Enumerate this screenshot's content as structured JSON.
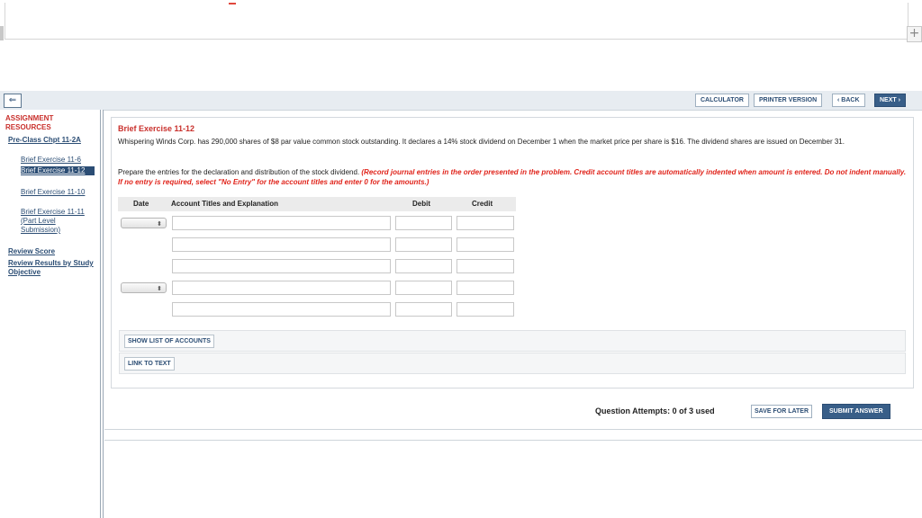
{
  "toolbar": {
    "toggle_icon": "list-toggle-icon",
    "calculator": "CALCULATOR",
    "printer_version": "PRINTER VERSION",
    "back": "‹ BACK",
    "next": "NEXT ›"
  },
  "sidebar": {
    "title": "ASSIGNMENT RESOURCES",
    "group": "Pre-Class Chpt 11-2A",
    "items": [
      {
        "label": "Brief Exercise 11-6"
      },
      {
        "label": "Brief Exercise 11-12"
      },
      {
        "label": "Brief Exercise 11-10"
      },
      {
        "label": "Brief Exercise 11-11 (Part Level Submission)"
      }
    ],
    "review_score": "Review Score",
    "review_results": "Review Results by Study Objective"
  },
  "exercise": {
    "title": "Brief Exercise 11-12",
    "description": "Whispering Winds Corp. has 290,000 shares of $8 par value common stock outstanding. It declares a 14% stock dividend on December 1 when the market price per share is $16. The dividend shares are issued on December 31.",
    "instruction_plain": "Prepare the entries for the declaration and distribution of the stock dividend. ",
    "instruction_red": "(Record journal entries in the order presented in the problem. Credit account titles are automatically indented when amount is entered. Do not indent manually. If no entry is required, select \"No Entry\" for the account titles and enter 0 for the amounts.)"
  },
  "table": {
    "headers": {
      "date": "Date",
      "account": "Account Titles and Explanation",
      "debit": "Debit",
      "credit": "Credit"
    },
    "select_arrow": "⬍"
  },
  "buttons": {
    "show_list": "SHOW LIST OF ACCOUNTS",
    "link_to_text": "LINK TO TEXT",
    "save_for_later": "SAVE FOR LATER",
    "submit_answer": "SUBMIT ANSWER"
  },
  "attempts": "Question Attempts: 0 of 3 used",
  "colors": {
    "accent": "#385e88",
    "brand_red": "#c9302c",
    "instruction_red": "#e0241b"
  }
}
